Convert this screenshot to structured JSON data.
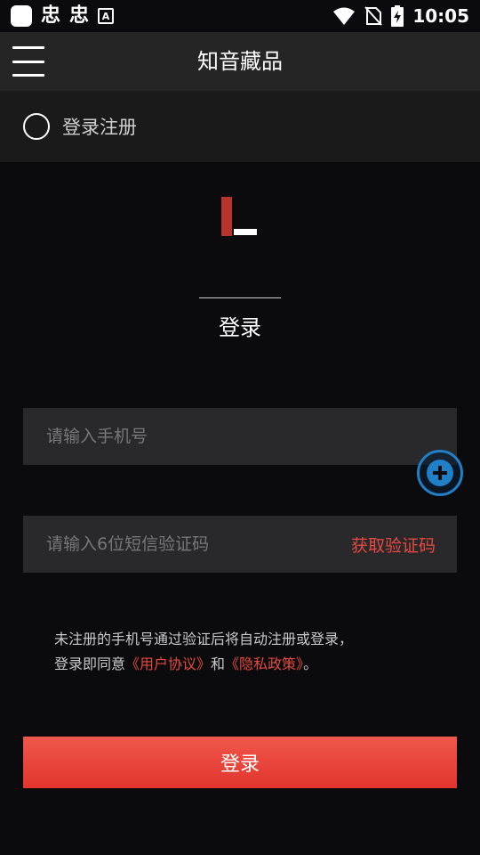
{
  "status_bar": {
    "glyph_1": "忠",
    "glyph_2": "忠",
    "a_badge": "A",
    "time": "10:05",
    "icons": [
      "app-square-icon",
      "wifi-icon",
      "no-sim-icon",
      "battery-charging-icon"
    ]
  },
  "header": {
    "title": "知音藏品"
  },
  "sub_header": {
    "label": "登录注册"
  },
  "logo": {
    "colors": {
      "bar": "#b8332c",
      "dash": "#ffffff"
    }
  },
  "tab": {
    "label": "登录"
  },
  "form": {
    "phone_placeholder": "请输入手机号",
    "code_placeholder": "请输入6位短信验证码",
    "get_code_label": "获取验证码"
  },
  "agreement": {
    "line1": "未注册的手机号通过验证后将自动注册或登录，",
    "line2_prefix": "登录即同意",
    "user_agreement": "《用户协议》",
    "and": "和",
    "privacy_policy": "《隐私政策》",
    "end": "。"
  },
  "login_button": {
    "label": "登录"
  },
  "colors": {
    "accent": "#e5493f",
    "fab": "#1f7fc7",
    "background": "#0b0b0d"
  }
}
